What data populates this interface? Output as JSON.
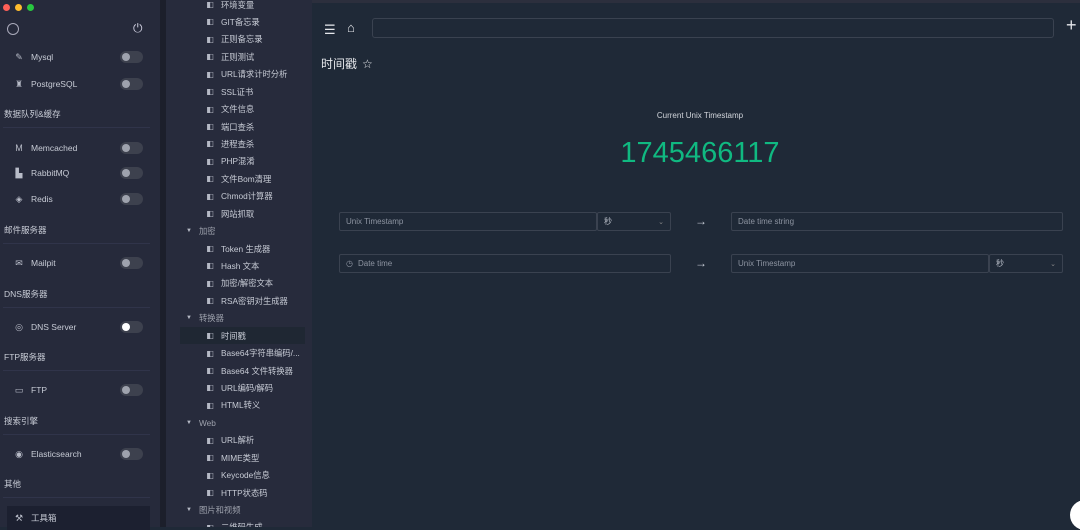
{
  "window": {
    "colors": {
      "close": "#fe5f57",
      "min": "#febc2e",
      "max": "#28c840"
    }
  },
  "sidebar": {
    "services": [
      {
        "label": "Mysql",
        "icon": "dolphin-icon",
        "on": false
      },
      {
        "label": "PostgreSQL",
        "icon": "elephant-icon",
        "on": false
      },
      {
        "label": "Memcached",
        "icon": "memcached-icon",
        "on": false
      },
      {
        "label": "RabbitMQ",
        "icon": "rabbitmq-icon",
        "on": false
      },
      {
        "label": "Redis",
        "icon": "redis-icon",
        "on": false
      },
      {
        "label": "Mailpit",
        "icon": "mail-icon",
        "on": false
      },
      {
        "label": "DNS Server",
        "icon": "dns-icon",
        "on": true
      },
      {
        "label": "FTP",
        "icon": "ftp-icon",
        "on": false
      },
      {
        "label": "Elasticsearch",
        "icon": "elasticsearch-icon",
        "on": false
      }
    ],
    "sections": [
      "数据队列&缓存",
      "邮件服务器",
      "DNS服务器",
      "FTP服务器",
      "搜索引擎",
      "其他"
    ],
    "toolbox": "工具箱"
  },
  "tools": [
    {
      "label": "环境变量",
      "g": false
    },
    {
      "label": "GIT备忘录",
      "g": false
    },
    {
      "label": "正则备忘录",
      "g": false
    },
    {
      "label": "正则测试",
      "g": false
    },
    {
      "label": "URL请求计时分析",
      "g": false
    },
    {
      "label": "SSL证书",
      "g": false
    },
    {
      "label": "文件信息",
      "g": false
    },
    {
      "label": "端口查杀",
      "g": false
    },
    {
      "label": "进程查杀",
      "g": false
    },
    {
      "label": "PHP混淆",
      "g": false
    },
    {
      "label": "文件Bom清理",
      "g": false
    },
    {
      "label": "Chmod计算器",
      "g": false
    },
    {
      "label": "网站抓取",
      "g": false
    },
    {
      "label": "加密",
      "g": true
    },
    {
      "label": "Token 生成器",
      "g": false
    },
    {
      "label": "Hash 文本",
      "g": false
    },
    {
      "label": "加密/解密文本",
      "g": false
    },
    {
      "label": "RSA密钥对生成器",
      "g": false
    },
    {
      "label": "转换器",
      "g": true
    },
    {
      "label": "时间戳",
      "g": false,
      "sel": true
    },
    {
      "label": "Base64字符串编码/...",
      "g": false
    },
    {
      "label": "Base64 文件转换器",
      "g": false
    },
    {
      "label": "URL编码/解码",
      "g": false
    },
    {
      "label": "HTML转义",
      "g": false
    },
    {
      "label": "Web",
      "g": true
    },
    {
      "label": "URL解析",
      "g": false
    },
    {
      "label": "MIME类型",
      "g": false
    },
    {
      "label": "Keycode信息",
      "g": false
    },
    {
      "label": "HTTP状态码",
      "g": false
    },
    {
      "label": "图片和视频",
      "g": true
    },
    {
      "label": "二维码生成",
      "g": false
    }
  ],
  "main": {
    "title": "时间戳",
    "current_label": "Current Unix Timestamp",
    "current_value": "1745466117",
    "accent": "#10b981",
    "row1": {
      "input_placeholder": "Unix Timestamp",
      "unit": "秒",
      "output_placeholder": "Date time string"
    },
    "row2": {
      "input_placeholder": "Date time",
      "output_placeholder": "Unix Timestamp",
      "unit": "秒"
    },
    "arrow": "→"
  }
}
